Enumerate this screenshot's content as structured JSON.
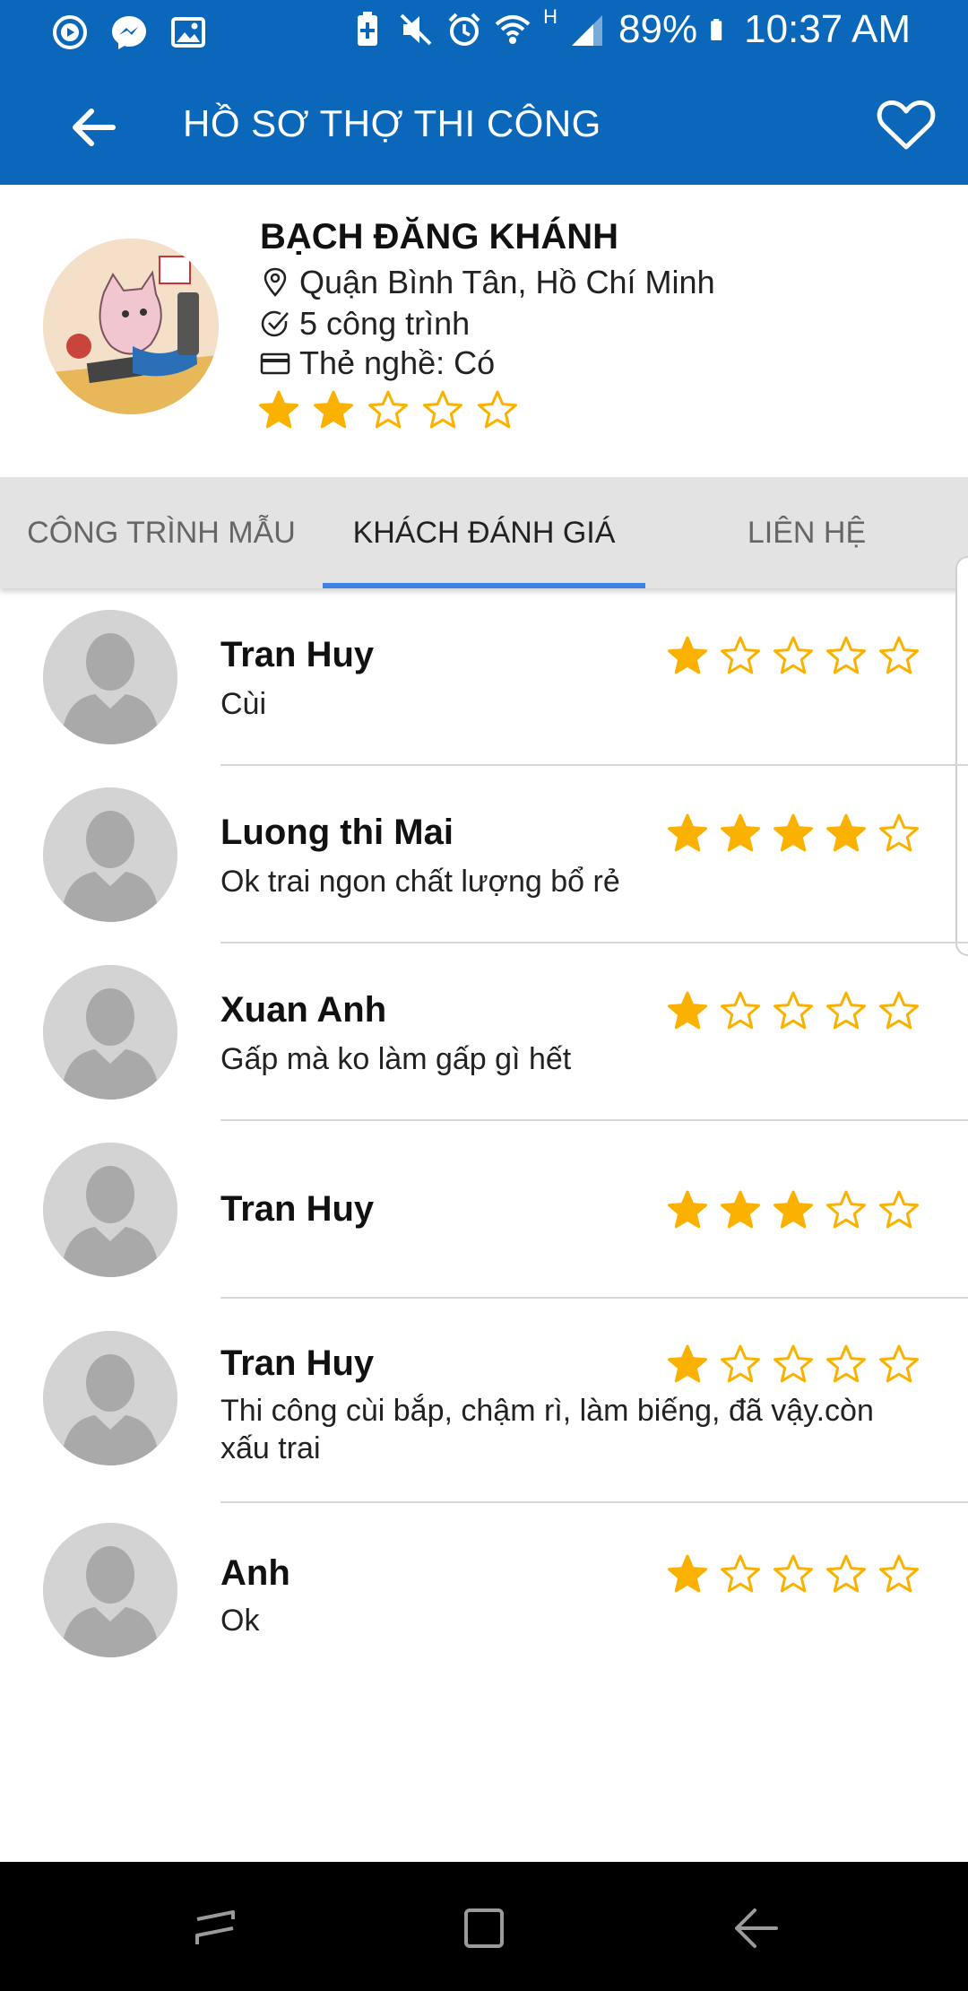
{
  "status_bar": {
    "battery": "89%",
    "time": "10:37 AM",
    "network_badge": "H",
    "icons_left": [
      "youtube-music-icon",
      "messenger-icon",
      "gallery-icon"
    ],
    "icons_right": [
      "battery-saver-icon",
      "mute-icon",
      "alarm-icon",
      "wifi-icon",
      "signal-icon",
      "battery-icon"
    ]
  },
  "app_bar": {
    "title": "HỒ SƠ THỢ THI CÔNG",
    "back_icon": "arrow-left-icon",
    "favorite_icon": "heart-outline-icon"
  },
  "profile": {
    "name": "BẠCH ĐĂNG KHÁNH",
    "location": "Quận Bình Tân, Hồ Chí Minh",
    "projects": "5 công trình",
    "license": "Thẻ nghề: Có",
    "rating": 2,
    "rating_max": 5
  },
  "tabs": [
    {
      "label": "CÔNG TRÌNH MẪU",
      "active": false
    },
    {
      "label": "KHÁCH ĐÁNH GIÁ",
      "active": true
    },
    {
      "label": "LIÊN HỆ",
      "active": false
    }
  ],
  "reviews": [
    {
      "name": "Tran Huy",
      "comment": "Cùi",
      "rating": 1
    },
    {
      "name": "Luong thi Mai",
      "comment": "Ok trai ngon chất lượng bổ rẻ",
      "rating": 4
    },
    {
      "name": "Xuan Anh",
      "comment": "Gấp mà ko làm gấp gì hết",
      "rating": 1
    },
    {
      "name": "Tran Huy",
      "comment": "",
      "rating": 3
    },
    {
      "name": "Tran Huy",
      "comment": "Thi công cùi bắp, chậm rì, làm biếng, đã vậy.còn xấu trai",
      "rating": 1
    },
    {
      "name": "Anh",
      "comment": "Ok",
      "rating": 1
    }
  ],
  "colors": {
    "primary": "#0a67b9",
    "star": "#fbb100",
    "tab_indicator": "#3d83e6",
    "tab_background": "#e3e3e3"
  },
  "nav_bar": {
    "icons": [
      "recent-apps-icon",
      "home-icon",
      "back-icon"
    ]
  }
}
